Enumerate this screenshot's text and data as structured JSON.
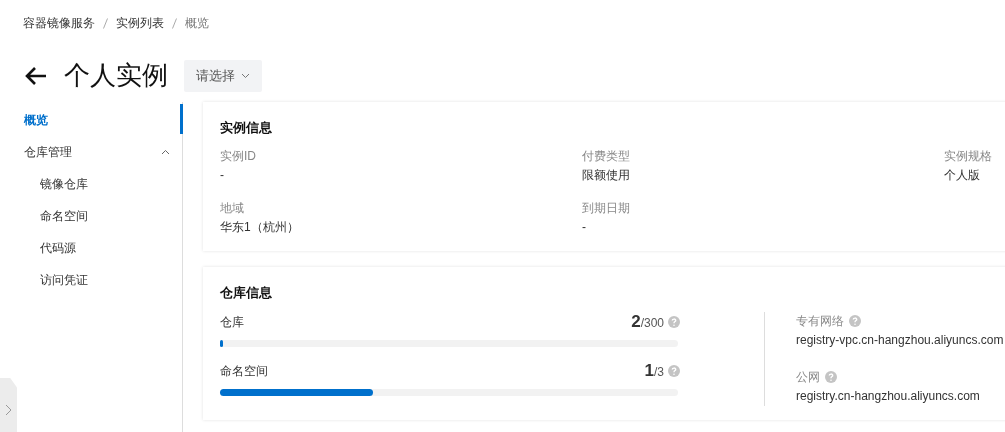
{
  "breadcrumb": [
    "容器镜像服务",
    "实例列表",
    "概览"
  ],
  "header": {
    "title": "个人实例",
    "select": {
      "placeholder": "请选择"
    }
  },
  "sidebar": {
    "items": [
      {
        "label": "概览",
        "selected": true
      },
      {
        "label": "仓库管理",
        "expanded": true,
        "selected": false,
        "children": [
          {
            "label": "镜像仓库",
            "selected": false
          },
          {
            "label": "命名空间",
            "selected": false
          },
          {
            "label": "代码源",
            "selected": false
          },
          {
            "label": "访问凭证",
            "selected": false
          }
        ]
      }
    ]
  },
  "instance_info": {
    "title": "实例信息",
    "fields": [
      {
        "label": "实例ID",
        "value": "-"
      },
      {
        "label": "付费类型",
        "value": "限额使用"
      },
      {
        "label": "实例规格",
        "value": "个人版"
      },
      {
        "label": "地域",
        "value": "华东1（杭州）"
      },
      {
        "label": "到期日期",
        "value": "-"
      }
    ]
  },
  "repo_info": {
    "title": "仓库信息",
    "quotas": [
      {
        "label": "仓库",
        "used": "2",
        "total": "/300",
        "level": 0.0067
      },
      {
        "label": "命名空间",
        "used": "1",
        "total": "/3",
        "level": 0.333
      }
    ],
    "endpoints": [
      {
        "label": "专有网络",
        "value": "registry-vpc.cn-hangzhou.aliyuncs.com"
      },
      {
        "label": "公网",
        "value": "registry.cn-hangzhou.aliyuncs.com"
      }
    ]
  }
}
